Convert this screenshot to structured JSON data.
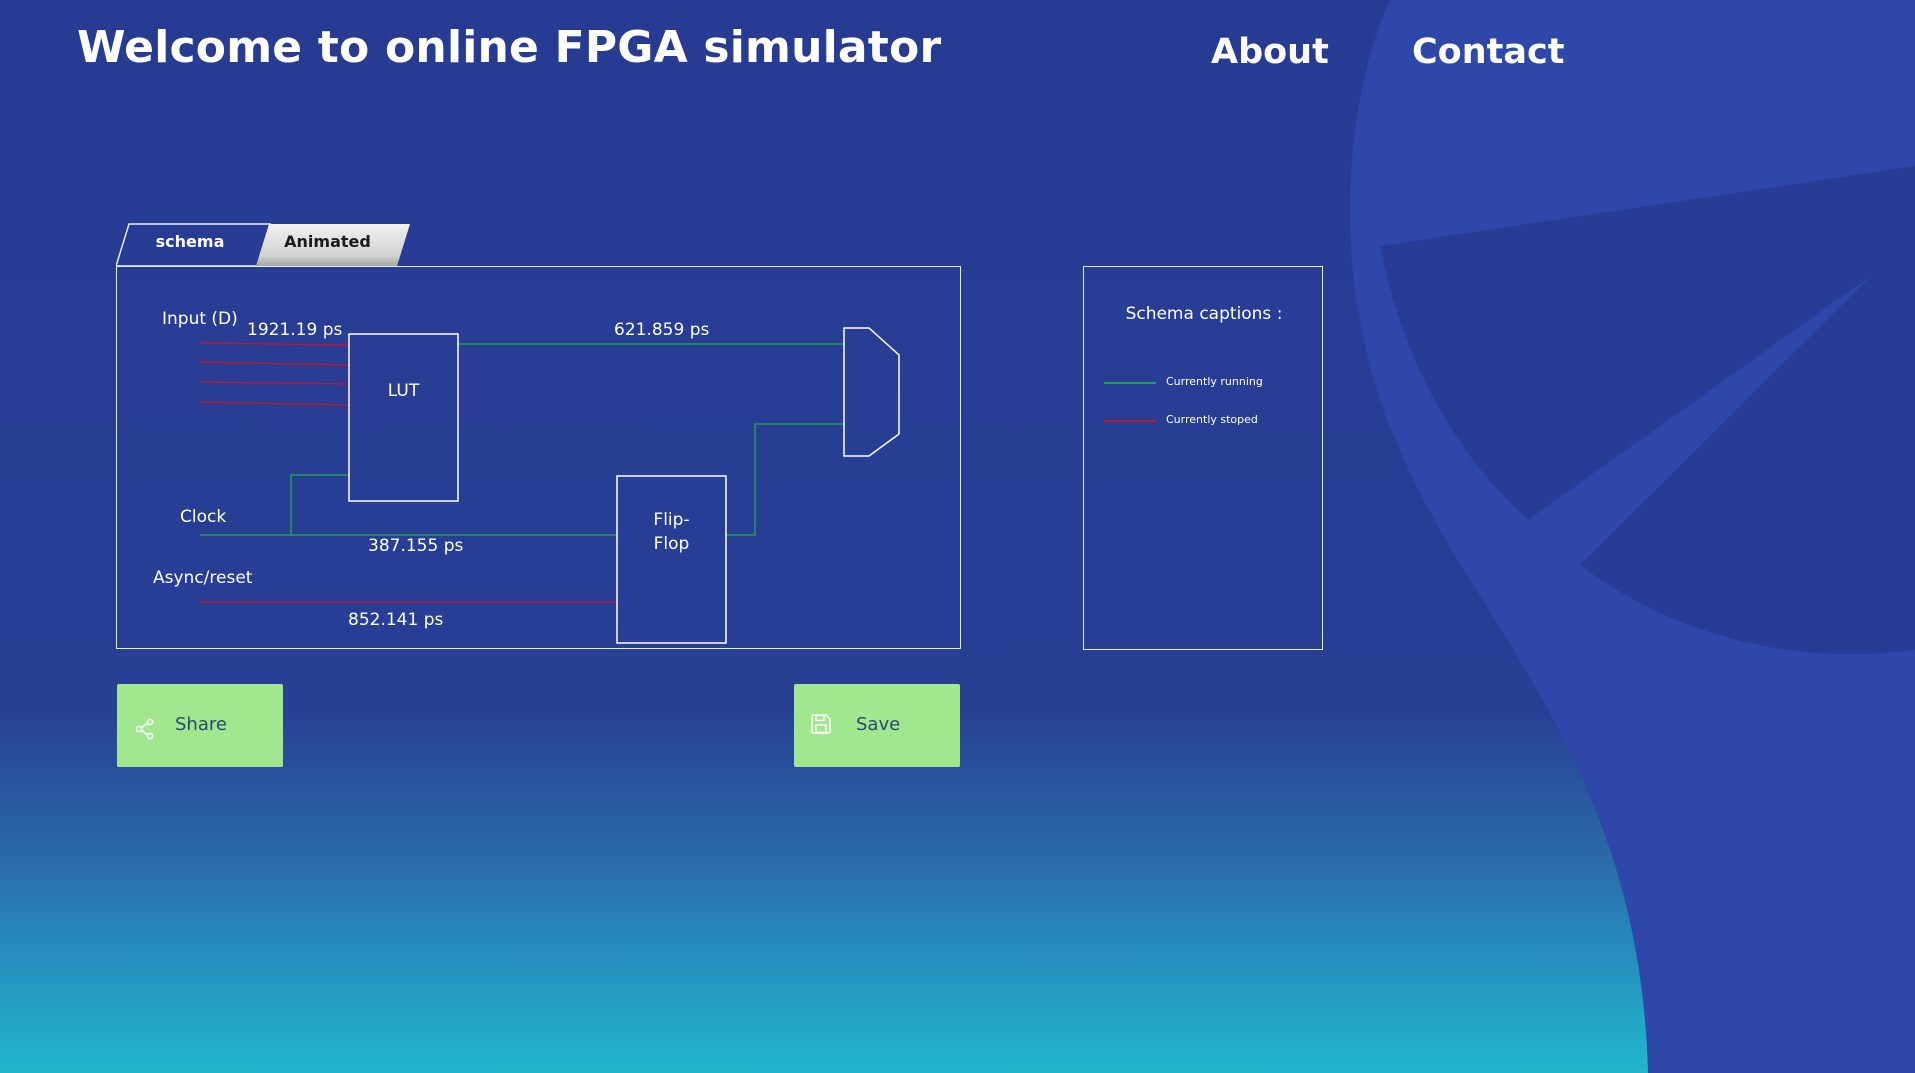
{
  "header": {
    "title": "Welcome to online FPGA simulator",
    "nav": {
      "about": "About",
      "contact": "Contact"
    }
  },
  "tabs": {
    "schema": "schema",
    "animated": "Animated",
    "active": "schema"
  },
  "schema": {
    "labels": {
      "input": "Input (D)",
      "clock": "Clock",
      "async_reset": "Async/reset",
      "lut": "LUT",
      "flipflop_line1": "Flip-",
      "flipflop_line2": "Flop"
    },
    "timings": {
      "input": "1921.19 ps",
      "lut_out": "621.859 ps",
      "clock": "387.155 ps",
      "reset": "852.141 ps"
    }
  },
  "captions": {
    "title": "Schema captions :",
    "running": "Currently running",
    "stopped": "Currently stoped"
  },
  "buttons": {
    "share": "Share",
    "save": "Save"
  },
  "colors": {
    "running": "#1fa050",
    "stopped": "#b01c3a",
    "button": "#a0e790"
  }
}
